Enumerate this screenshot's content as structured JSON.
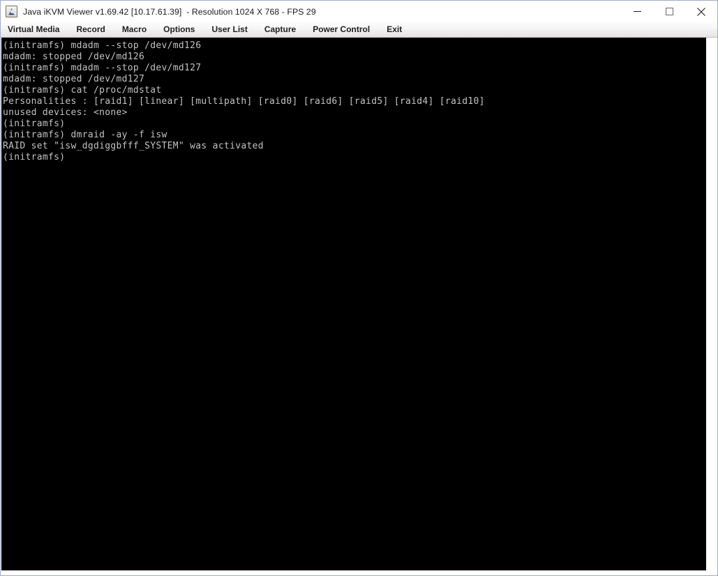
{
  "window": {
    "title": "Java iKVM Viewer v1.69.42 [10.17.61.39]  - Resolution 1024 X 768 - FPS 29",
    "icon": "java-coffee-cup-icon",
    "controls": {
      "minimize": "minimize-icon",
      "maximize": "maximize-icon",
      "close": "close-icon"
    }
  },
  "menubar": {
    "items": [
      {
        "label": "Virtual Media"
      },
      {
        "label": "Record"
      },
      {
        "label": "Macro"
      },
      {
        "label": "Options"
      },
      {
        "label": "User List"
      },
      {
        "label": "Capture"
      },
      {
        "label": "Power Control"
      },
      {
        "label": "Exit"
      }
    ]
  },
  "terminal": {
    "background_color": "#000000",
    "text_color": "#c2c2c2",
    "lines": [
      "(initramfs) mdadm --stop /dev/md126",
      "mdadm: stopped /dev/md126",
      "(initramfs) mdadm --stop /dev/md127",
      "mdadm: stopped /dev/md127",
      "(initramfs) cat /proc/mdstat",
      "Personalities : [raid1] [linear] [multipath] [raid0] [raid6] [raid5] [raid4] [raid10]",
      "unused devices: <none>",
      "(initramfs)",
      "(initramfs) dmraid -ay -f isw",
      "RAID set \"isw_dgdiggbfff_SYSTEM\" was activated",
      "(initramfs)"
    ]
  }
}
